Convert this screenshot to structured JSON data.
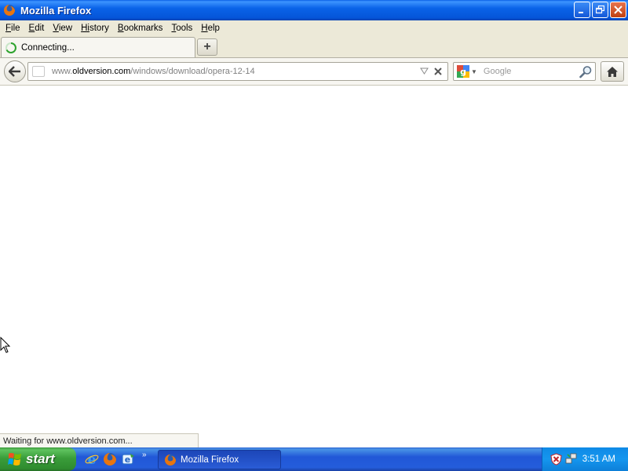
{
  "window": {
    "title": "Mozilla Firefox"
  },
  "menu": [
    {
      "first": "F",
      "rest": "ile"
    },
    {
      "first": "E",
      "rest": "dit"
    },
    {
      "first": "V",
      "rest": "iew"
    },
    {
      "first": "Hi",
      "rest": "story"
    },
    {
      "first": "B",
      "rest": "ookmarks"
    },
    {
      "first": "T",
      "rest": "ools"
    },
    {
      "first": "H",
      "rest": "elp"
    }
  ],
  "tab": {
    "label": "Connecting..."
  },
  "newtab": {
    "label": "+"
  },
  "urlbar": {
    "prefix": "www.",
    "domain": "oldversion.com",
    "path": "/windows/download/opera-12-14"
  },
  "search": {
    "placeholder": "Google"
  },
  "status": {
    "text": "Waiting for www.oldversion.com..."
  },
  "taskbar": {
    "start_label": "start",
    "task_label": "Mozilla Firefox",
    "clock": "3:51 AM"
  },
  "icons": {
    "app": "firefox-icon",
    "minimize": "minimize-icon",
    "restore": "restore-icon",
    "close": "close-icon",
    "tab_loading": "loading-spinner-icon",
    "back": "back-arrow-icon",
    "site_identity": "site-identity-icon",
    "url_dropdown": "dropdown-triangle-icon",
    "url_stop": "stop-icon",
    "search_engine": "google-icon",
    "search_go": "magnifier-icon",
    "home": "home-icon",
    "windows_logo": "windows-logo-icon",
    "ie": "internet-explorer-icon",
    "outlook": "outlook-express-icon",
    "tray_security": "security-shield-icon",
    "tray_network": "network-icon"
  }
}
